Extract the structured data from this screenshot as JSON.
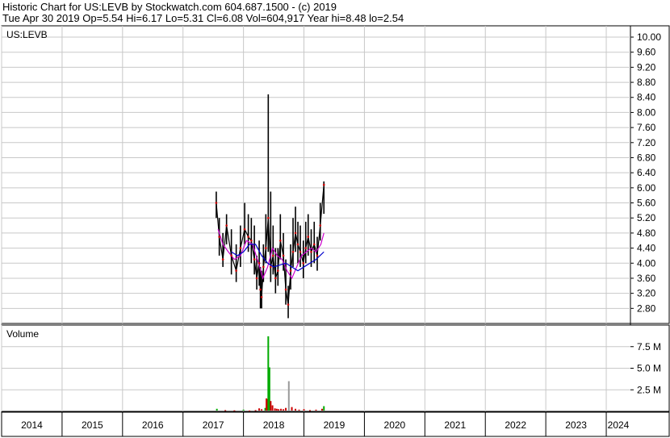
{
  "header": {
    "line1": "Historic Chart for US:LEVB by Stockwatch.com 604.687.1500 - (c) 2019",
    "line2": "Tue Apr 30 2019  Op=5.54  Hi=6.17  Lo=5.31  Cl=6.08  Vol=604,917  Year hi=8.48  lo=2.54"
  },
  "chart_data": [
    {
      "type": "line",
      "panel": "price",
      "title": "US:LEVB",
      "xlabel": "",
      "ylabel": "",
      "ylim": [
        2.4,
        10.3
      ],
      "yticks": [
        "10.00",
        "9.60",
        "9.20",
        "8.80",
        "8.40",
        "8.00",
        "7.60",
        "7.20",
        "6.80",
        "6.40",
        "6.00",
        "5.60",
        "5.20",
        "4.80",
        "4.40",
        "4.00",
        "3.60",
        "3.20",
        "2.80"
      ],
      "grid": true,
      "colors": {
        "price": "#000000",
        "close_markers": "#cc0000",
        "ma_short": "#cc00cc",
        "ma_long": "#0000cc",
        "grid": "#c8c8c8"
      },
      "series": [
        {
          "x": [
            2017.55,
            2017.6,
            2017.66,
            2017.72,
            2017.8,
            2017.88,
            2017.95,
            2018.02,
            2018.08,
            2018.13,
            2018.18,
            2018.22,
            2018.26,
            2018.28,
            2018.3,
            2018.33,
            2018.37,
            2018.41,
            2018.45,
            2018.49,
            2018.53,
            2018.57,
            2018.61,
            2018.66,
            2018.7,
            2018.74,
            2018.78,
            2018.82,
            2018.86,
            2018.9,
            2018.94,
            2018.99,
            2019.03,
            2019.07,
            2019.12,
            2019.17,
            2019.22,
            2019.27,
            2019.33
          ],
          "values": [
            5.6,
            4.7,
            4.1,
            5.0,
            4.2,
            3.8,
            4.4,
            4.9,
            4.7,
            4.6,
            4.1,
            3.6,
            4.0,
            3.3,
            3.1,
            3.9,
            4.4,
            5.2,
            3.9,
            4.2,
            3.6,
            3.8,
            4.6,
            4.2,
            3.3,
            2.9,
            3.8,
            4.3,
            4.8,
            4.5,
            4.3,
            4.0,
            4.4,
            4.7,
            4.3,
            4.5,
            4.2,
            5.0,
            6.08
          ]
        },
        {
          "x": [
            2017.58,
            2017.66,
            2017.75,
            2017.85,
            2017.95,
            2018.05,
            2018.15,
            2018.25,
            2018.32,
            2018.4,
            2018.48,
            2018.56,
            2018.64,
            2018.72,
            2018.8,
            2018.88,
            2018.96,
            2019.04,
            2019.12,
            2019.2,
            2019.28,
            2019.33
          ],
          "values": [
            4.9,
            4.5,
            4.3,
            4.1,
            4.2,
            4.6,
            4.5,
            4.0,
            3.6,
            3.9,
            4.4,
            4.2,
            4.1,
            3.8,
            3.6,
            3.9,
            4.2,
            4.3,
            4.4,
            4.3,
            4.5,
            4.8
          ]
        },
        {
          "x": [
            2017.8,
            2017.9,
            2018.0,
            2018.1,
            2018.2,
            2018.3,
            2018.4,
            2018.5,
            2018.6,
            2018.7,
            2018.8,
            2018.9,
            2019.0,
            2019.1,
            2019.2,
            2019.33
          ],
          "values": [
            4.3,
            4.2,
            4.3,
            4.5,
            4.5,
            4.2,
            4.0,
            3.9,
            3.95,
            4.0,
            3.9,
            3.8,
            3.9,
            4.0,
            4.1,
            4.3
          ]
        }
      ],
      "bars": {
        "x": [
          2017.55,
          2017.6,
          2017.66,
          2017.72,
          2017.8,
          2017.88,
          2017.95,
          2018.02,
          2018.08,
          2018.13,
          2018.18,
          2018.22,
          2018.26,
          2018.28,
          2018.3,
          2018.33,
          2018.37,
          2018.41,
          2018.45,
          2018.49,
          2018.53,
          2018.57,
          2018.61,
          2018.66,
          2018.7,
          2018.74,
          2018.78,
          2018.82,
          2018.86,
          2018.9,
          2018.94,
          2018.99,
          2019.03,
          2019.07,
          2019.12,
          2019.17,
          2019.22,
          2019.27,
          2019.33
        ],
        "high": [
          5.9,
          5.2,
          4.8,
          5.3,
          4.9,
          4.5,
          5.0,
          5.6,
          5.3,
          5.2,
          5.0,
          4.2,
          4.6,
          3.9,
          3.8,
          4.5,
          5.3,
          8.48,
          5.9,
          5.0,
          4.4,
          4.4,
          5.3,
          4.8,
          4.1,
          3.4,
          4.5,
          5.2,
          5.5,
          5.1,
          5.0,
          4.6,
          5.1,
          5.3,
          4.9,
          5.1,
          4.7,
          5.6,
          6.17
        ],
        "low": [
          5.2,
          4.2,
          3.9,
          4.5,
          3.7,
          3.5,
          3.9,
          4.5,
          4.3,
          4.0,
          3.7,
          3.3,
          3.4,
          2.8,
          2.8,
          3.5,
          4.0,
          4.3,
          3.5,
          3.7,
          3.2,
          3.4,
          4.1,
          3.8,
          2.9,
          2.54,
          3.3,
          3.9,
          4.3,
          4.0,
          3.9,
          3.6,
          4.0,
          4.2,
          3.9,
          4.0,
          3.8,
          4.6,
          5.31
        ]
      }
    },
    {
      "type": "bar",
      "panel": "volume",
      "title": "Volume",
      "xlabel": "",
      "ylabel": "",
      "ylim": [
        0,
        10000000
      ],
      "yticks": [
        "7.5 M",
        "5.0 M",
        "2.5 M"
      ],
      "grid": true,
      "colors": {
        "up": "#00aa00",
        "down": "#cc0000",
        "neutral": "#999999"
      },
      "x": [
        2017.56,
        2017.7,
        2017.85,
        2018.0,
        2018.1,
        2018.2,
        2018.26,
        2018.3,
        2018.36,
        2018.38,
        2018.4,
        2018.41,
        2018.43,
        2018.45,
        2018.48,
        2018.52,
        2018.55,
        2018.58,
        2018.62,
        2018.66,
        2018.7,
        2018.75,
        2018.8,
        2018.86,
        2018.92,
        2019.0,
        2019.1,
        2019.2,
        2019.3,
        2019.33
      ],
      "values": [
        300000,
        150000,
        120000,
        200000,
        100000,
        150000,
        350000,
        250000,
        400000,
        1500000,
        1400000,
        8700000,
        5100000,
        1200000,
        700000,
        350000,
        300000,
        250000,
        300000,
        250000,
        400000,
        3500000,
        500000,
        300000,
        200000,
        250000,
        150000,
        200000,
        300000,
        604917
      ],
      "direction": [
        "up",
        "down",
        "down",
        "up",
        "down",
        "down",
        "down",
        "down",
        "up",
        "down",
        "down",
        "up",
        "up",
        "down",
        "down",
        "down",
        "down",
        "down",
        "down",
        "down",
        "down",
        "neutral",
        "down",
        "down",
        "down",
        "down",
        "down",
        "down",
        "down",
        "up"
      ]
    }
  ],
  "x_axis": {
    "years": [
      "2014",
      "2015",
      "2016",
      "2017",
      "2018",
      "2019",
      "2020",
      "2021",
      "2022",
      "2023",
      "2024"
    ],
    "start": 2014,
    "end": 2024.4
  }
}
